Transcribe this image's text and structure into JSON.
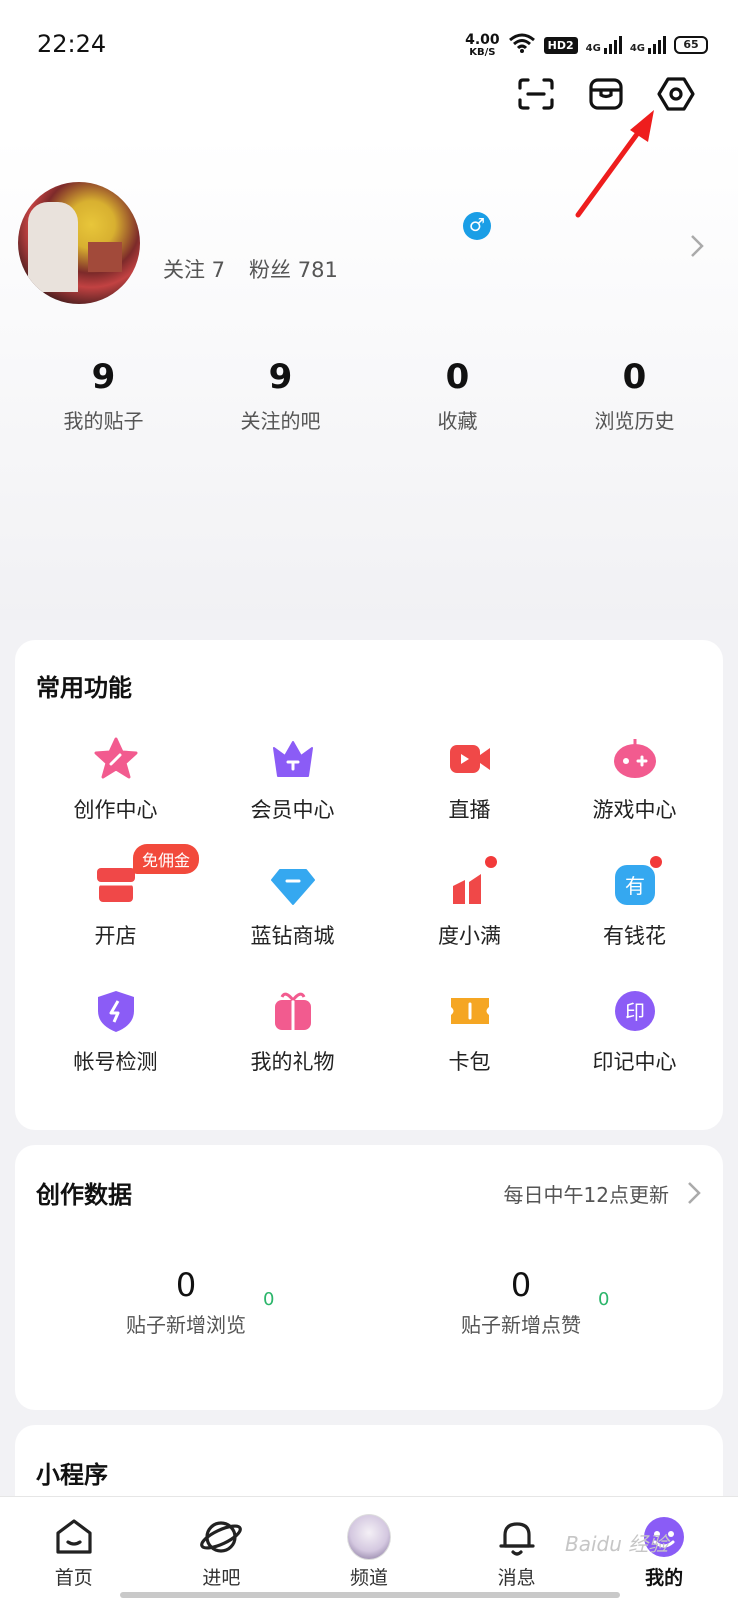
{
  "status_bar": {
    "time": "22:24",
    "net_speed_value": "4.00",
    "net_speed_unit": "KB/S",
    "hd_label": "HD2",
    "signal1": "4G",
    "signal2": "4G",
    "battery": "65"
  },
  "header": {
    "icons": [
      "scan-icon",
      "box-icon",
      "settings-icon"
    ]
  },
  "profile": {
    "follow_label": "关注 7",
    "fans_label": "粉丝 781",
    "gender_symbol": "♂"
  },
  "stats": [
    {
      "value": "9",
      "label": "我的贴子"
    },
    {
      "value": "9",
      "label": "关注的吧"
    },
    {
      "value": "0",
      "label": "收藏"
    },
    {
      "value": "0",
      "label": "浏览历史"
    }
  ],
  "common_functions": {
    "title": "常用功能",
    "items": [
      {
        "label": "创作中心",
        "icon": "star-pen-icon",
        "color": "#f25b8f"
      },
      {
        "label": "会员中心",
        "icon": "crown-icon",
        "color": "#8b5cf6"
      },
      {
        "label": "直播",
        "icon": "video-camera-icon",
        "color": "#f04848"
      },
      {
        "label": "游戏中心",
        "icon": "gamepad-icon",
        "color": "#f25b8f"
      },
      {
        "label": "开店",
        "icon": "shop-icon",
        "color": "#f04848",
        "badge": "免佣金"
      },
      {
        "label": "蓝钻商城",
        "icon": "diamond-icon",
        "color": "#35a8f0"
      },
      {
        "label": "度小满",
        "icon": "chart-icon",
        "color": "#f04848"
      },
      {
        "label": "有钱花",
        "icon": "you-icon",
        "color": "#35a8f0"
      },
      {
        "label": "帐号检测",
        "icon": "shield-icon",
        "color": "#8b5cf6"
      },
      {
        "label": "我的礼物",
        "icon": "gift-icon",
        "color": "#f25b8f"
      },
      {
        "label": "卡包",
        "icon": "ticket-icon",
        "color": "#f5a623"
      },
      {
        "label": "印记中心",
        "icon": "seal-icon",
        "color": "#8b5cf6"
      }
    ],
    "badge_icon_glyphs": {
      "you": "有",
      "seal": "印"
    }
  },
  "creation_data": {
    "title": "创作数据",
    "update_note": "每日中午12点更新",
    "metrics": [
      {
        "value": "0",
        "delta": "0",
        "label": "贴子新增浏览"
      },
      {
        "value": "0",
        "delta": "0",
        "label": "贴子新增点赞"
      }
    ]
  },
  "mini_programs": {
    "title": "小程序"
  },
  "bottom_nav": [
    {
      "label": "首页",
      "icon": "home-icon"
    },
    {
      "label": "进吧",
      "icon": "planet-icon"
    },
    {
      "label": "频道",
      "icon": "channel-avatar"
    },
    {
      "label": "消息",
      "icon": "bell-icon"
    },
    {
      "label": "我的",
      "icon": "smiley-icon"
    }
  ],
  "watermark": "Baidu 经验"
}
